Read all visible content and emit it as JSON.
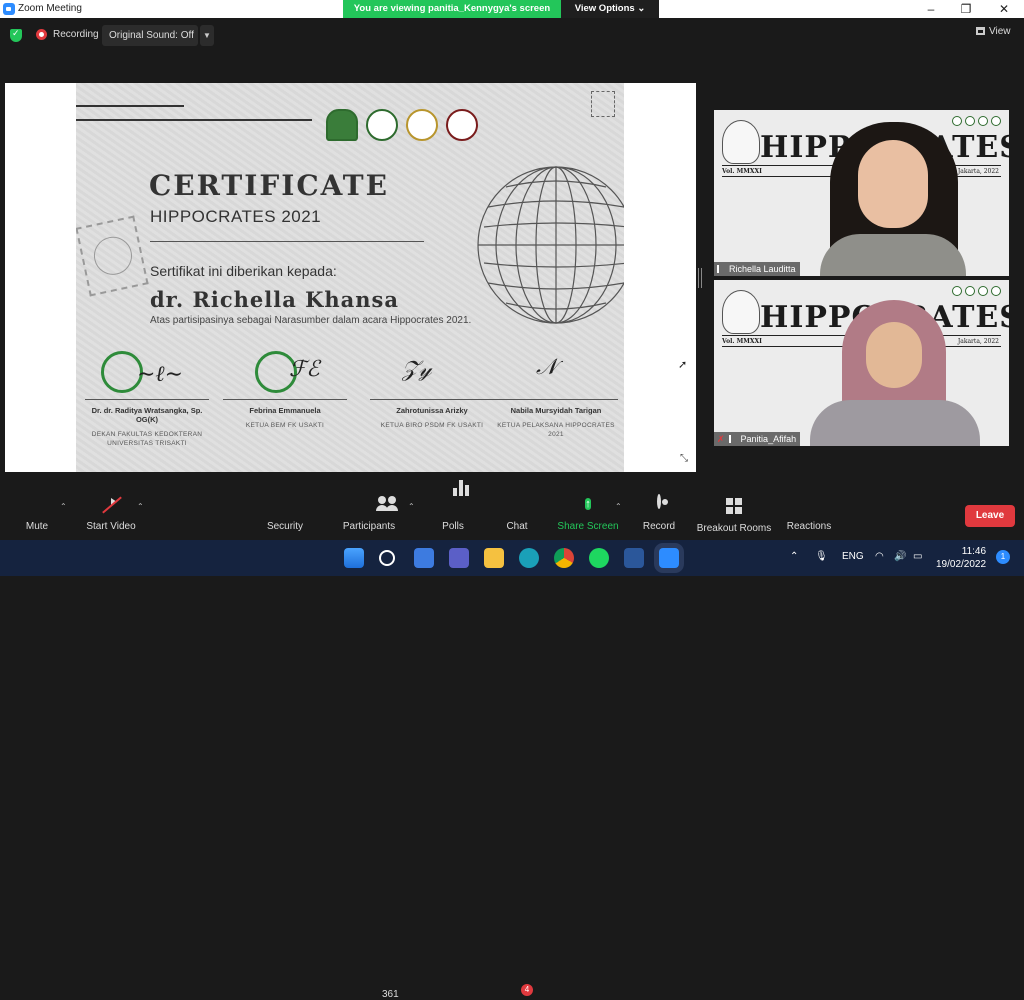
{
  "window": {
    "title": "Zoom Meeting",
    "minimize": "–",
    "maximize": "❐",
    "close": "✕"
  },
  "banner": {
    "viewing": "You are viewing panitia_Kennygya's screen",
    "options": "View Options ⌄"
  },
  "topbar": {
    "recording": "Recording",
    "original_sound": "Original Sound: Off",
    "view": "View"
  },
  "certificate": {
    "title": "CERTIFICATE",
    "subtitle": "HIPPOCRATES 2021",
    "intro": "Sertifikat ini diberikan kepada:",
    "recipient": "dr. Richella Khansa",
    "participation": "Atas partisipasinya sebagai Narasumber dalam acara Hippocrates 2021.",
    "signatories": [
      {
        "name": "Dr. dr. Raditya Wratsangka, Sp. OG(K)",
        "role": "DEKAN FAKULTAS KEDOKTERAN UNIVERSITAS TRISAKTI"
      },
      {
        "name": "Febrina Emmanuela",
        "role": "KETUA BEM FK USAKTI"
      },
      {
        "name": "Zahrotunissa Arizky",
        "role": "KETUA BIRO PSDM FK USAKTI"
      },
      {
        "name": "Nabila Mursyidah Tarigan",
        "role": "KETUA PELAKSANA HIPPOCRATES 2021"
      }
    ]
  },
  "participants_tiles": [
    {
      "name": "Richella Lauditta",
      "brand": "HIPPOCRATES",
      "vol": "Vol. MMXXI",
      "city": "Jakarta, 2022",
      "muted": false
    },
    {
      "name": "Panitia_Afifah",
      "brand": "HIPPOCRATES",
      "vol": "Vol. MMXXI",
      "city": "Jakarta, 2022",
      "muted": true
    }
  ],
  "toolbar": {
    "mute": "Mute",
    "start_video": "Start Video",
    "security": "Security",
    "participants": "Participants",
    "participants_count": "361",
    "polls": "Polls",
    "chat": "Chat",
    "chat_badge": "4",
    "share_screen": "Share Screen",
    "record": "Record",
    "breakout_rooms": "Breakout Rooms",
    "reactions": "Reactions",
    "leave": "Leave"
  },
  "taskbar": {
    "lang": "ENG",
    "time": "11:46",
    "date": "19/02/2022",
    "notifications": "1"
  },
  "colors": {
    "zoom_blue": "#2d8cff",
    "share_green": "#23c65a",
    "leave_red": "#e0393e"
  }
}
